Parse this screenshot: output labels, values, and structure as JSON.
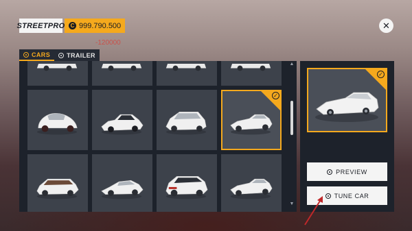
{
  "header": {
    "brand": "STREETPRO",
    "coins": "999.790.500",
    "coin_symbol": "C",
    "delta": "-120000",
    "close_label": "✕"
  },
  "tabs": [
    {
      "label": "CARS",
      "active": true
    },
    {
      "label": "TRAILER",
      "active": false
    }
  ],
  "grid": {
    "tiles": [
      {
        "row": 0,
        "col": 0,
        "car": "sedan-partial"
      },
      {
        "row": 0,
        "col": 1,
        "car": "sedan-partial"
      },
      {
        "row": 0,
        "col": 2,
        "car": "sedan-partial"
      },
      {
        "row": 0,
        "col": 3,
        "car": "sedan-partial"
      },
      {
        "row": 1,
        "col": 0,
        "car": "beetle"
      },
      {
        "row": 1,
        "col": 1,
        "car": "coupe-80s"
      },
      {
        "row": 1,
        "col": 2,
        "car": "hatchback"
      },
      {
        "row": 1,
        "col": 3,
        "car": "muscle",
        "selected": true
      },
      {
        "row": 2,
        "col": 0,
        "car": "wagon"
      },
      {
        "row": 2,
        "col": 1,
        "car": "sports-coupe"
      },
      {
        "row": 2,
        "col": 2,
        "car": "suv"
      },
      {
        "row": 2,
        "col": 3,
        "car": "muscle"
      }
    ],
    "check_glyph": "✓"
  },
  "side": {
    "preview_label": "PREVIEW",
    "tune_label": "TUNE CAR",
    "check_glyph": "✓"
  },
  "colors": {
    "accent": "#f5a91d",
    "panel": "#1d222b",
    "tile": "#3d424b",
    "annotation_arrow": "#c0282a"
  }
}
